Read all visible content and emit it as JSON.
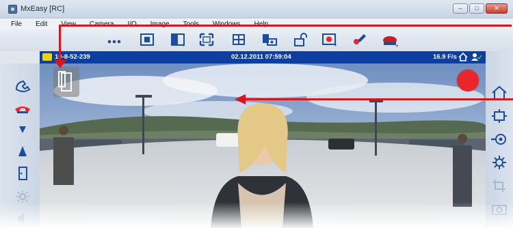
{
  "window": {
    "title": "MxEasy [RC]",
    "minimize_glyph": "–",
    "maximize_glyph": "□",
    "close_glyph": "✕"
  },
  "menu": {
    "items": [
      "File",
      "Edit",
      "View",
      "Camera",
      "I/O",
      "Image",
      "Tools",
      "Windows",
      "Help"
    ]
  },
  "toolbar": {
    "icons": [
      "more-dots-icon",
      "layout-grid-icon",
      "split-view-icon",
      "fullscreen-icon",
      "quad-view-icon",
      "camera-group-icon",
      "unlock-icon",
      "record-monitor-icon",
      "tools-icon",
      "alarm-bell-icon"
    ]
  },
  "statusbar": {
    "camera_ip": "10-8-52-239",
    "timestamp": "02.12.2011 07:59:04",
    "fps": "16.9 F/s"
  },
  "left_sidebar": {
    "icons": [
      "handset-pickup-icon",
      "handset-hangup-icon",
      "volume-down-icon",
      "volume-up-icon",
      "door-open-icon",
      "light-icon",
      "speaker-icon"
    ]
  },
  "right_sidebar": {
    "icons": [
      "home-icon",
      "pan-icon",
      "zoom-in-icon",
      "settings-icon",
      "crop-icon",
      "snapshot-icon"
    ]
  },
  "colors": {
    "status_blue": "#0d3ea0",
    "annotation_red": "#d8161c",
    "record_red": "#e8262c",
    "toolbar_icon": "#1f4c9a"
  }
}
